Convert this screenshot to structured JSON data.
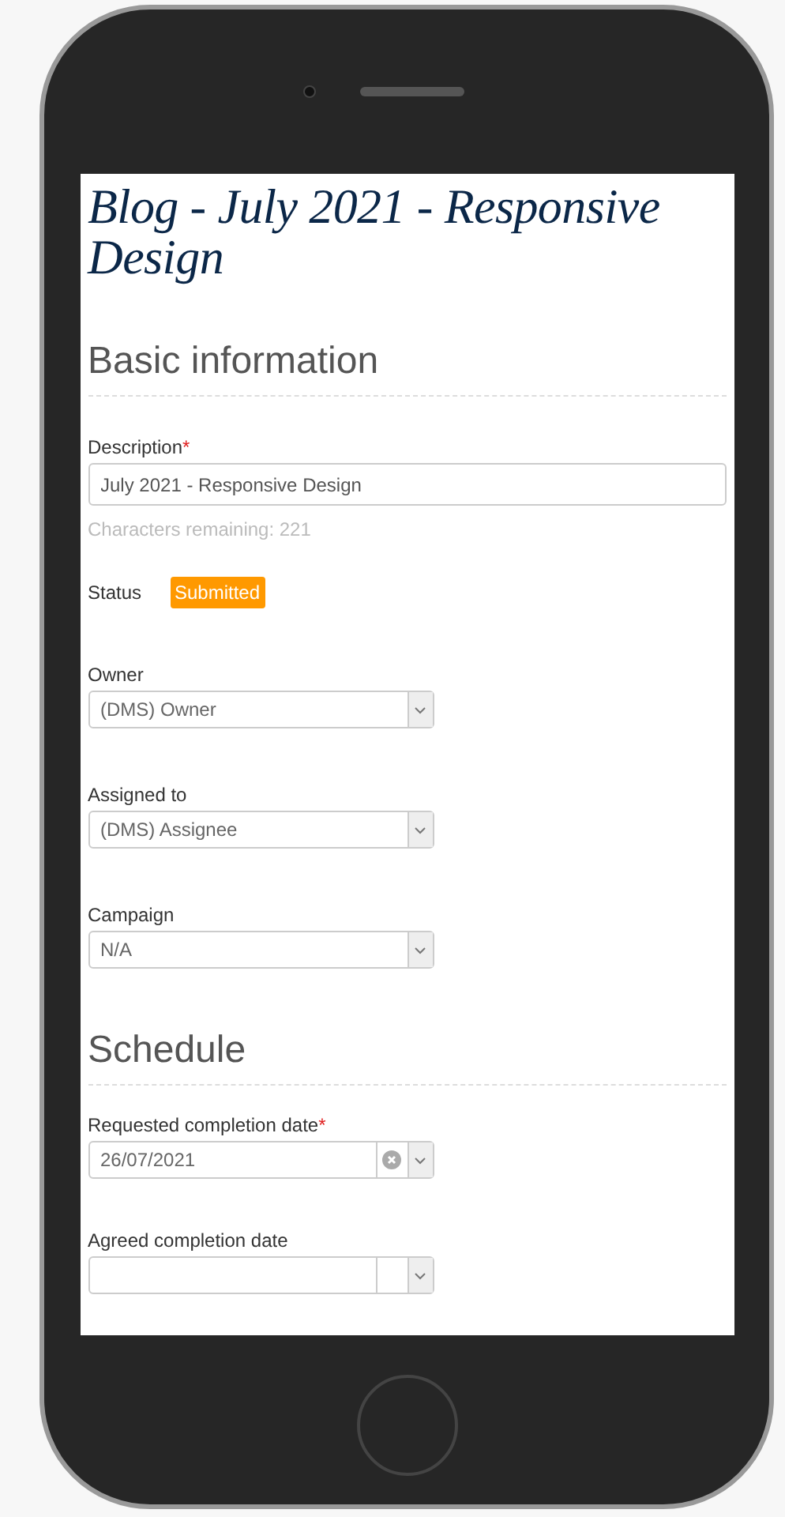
{
  "title": "Blog - July 2021 - Responsive Design",
  "sections": [
    {
      "heading": "Basic information",
      "fields": [
        {
          "kind": "text",
          "label": "Description",
          "required_mark": "*",
          "value": "July 2021 - Responsive Design",
          "hint": "Characters remaining: 221"
        },
        {
          "kind": "status",
          "label": "Status",
          "badge": "Submitted",
          "color": "#ff9900"
        },
        {
          "kind": "select",
          "label": "Owner",
          "value": "(DMS) Owner"
        },
        {
          "kind": "select",
          "label": "Assigned to",
          "value": "(DMS) Assignee"
        },
        {
          "kind": "select",
          "label": "Campaign",
          "value": "N/A"
        }
      ]
    },
    {
      "heading": "Schedule",
      "fields": [
        {
          "kind": "date",
          "label": "Requested completion date",
          "required_mark": "*",
          "value": "26/07/2021"
        },
        {
          "kind": "date",
          "label": "Agreed completion date"
        }
      ]
    }
  ]
}
